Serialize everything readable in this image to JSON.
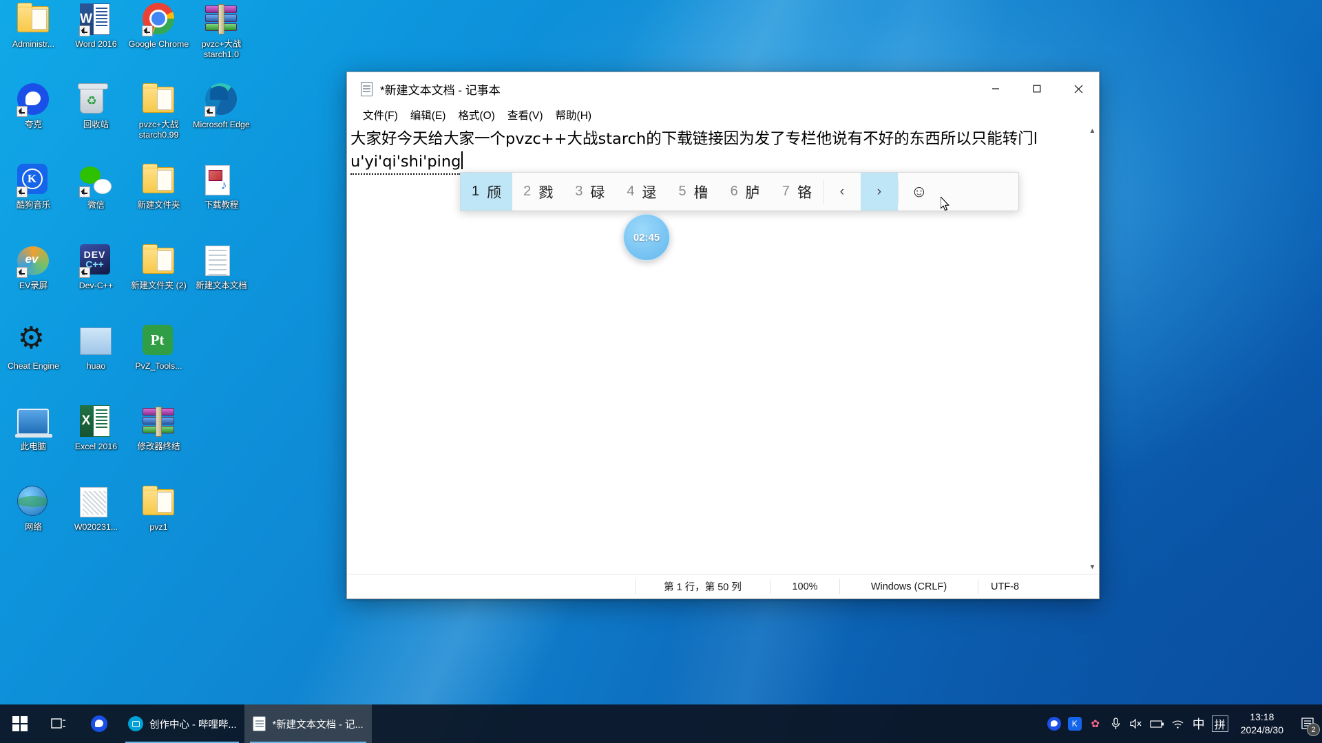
{
  "desktop": {
    "icons": [
      {
        "label": "Administr...",
        "icon": "user-folder-icon"
      },
      {
        "label": "Word 2016",
        "icon": "word-icon"
      },
      {
        "label": "Google Chrome",
        "icon": "chrome-icon"
      },
      {
        "label": "pvzc+大战starch1.0",
        "icon": "winrar-archive-icon"
      },
      {
        "label": "夸克",
        "icon": "quark-browser-icon"
      },
      {
        "label": "回收站",
        "icon": "recycle-bin-icon"
      },
      {
        "label": "pvzc+大战starch0.99",
        "icon": "folder-icon"
      },
      {
        "label": "Microsoft Edge",
        "icon": "edge-icon"
      },
      {
        "label": "酷狗音乐",
        "icon": "kugou-music-icon"
      },
      {
        "label": "微信",
        "icon": "wechat-icon"
      },
      {
        "label": "新建文件夹",
        "icon": "folder-icon"
      },
      {
        "label": "下载教程",
        "icon": "media-file-icon"
      },
      {
        "label": "EV录屏",
        "icon": "ev-recorder-icon"
      },
      {
        "label": "Dev-C++",
        "icon": "dev-cpp-icon"
      },
      {
        "label": "新建文件夹 (2)",
        "icon": "folder-icon"
      },
      {
        "label": "新建文本文档",
        "icon": "text-document-icon"
      },
      {
        "label": "Cheat Engine",
        "icon": "cheat-engine-icon"
      },
      {
        "label": "huao",
        "icon": "image-file-icon"
      },
      {
        "label": "PvZ_Tools...",
        "icon": "pvz-tools-icon"
      },
      {
        "label": "",
        "icon": "blank-icon"
      },
      {
        "label": "此电脑",
        "icon": "this-pc-icon"
      },
      {
        "label": "Excel 2016",
        "icon": "excel-icon"
      },
      {
        "label": "修改器终结",
        "icon": "winrar-archive-icon"
      },
      {
        "label": "",
        "icon": "blank-icon"
      },
      {
        "label": "网络",
        "icon": "network-icon"
      },
      {
        "label": "W020231...",
        "icon": "image-file-icon"
      },
      {
        "label": "pvz1",
        "icon": "folder-icon"
      }
    ]
  },
  "notepad": {
    "title": "*新建文本文档 - 记事本",
    "icon": "notepad-icon",
    "menus": [
      "文件(F)",
      "编辑(E)",
      "格式(O)",
      "查看(V)",
      "帮助(H)"
    ],
    "window_buttons": {
      "minimize": "minimize-button",
      "maximize": "maximize-button",
      "close": "close-button"
    },
    "text_line1": "大家好今天给大家一个pvzc++大战starch的下载链接因为发了专栏他说有不好的东西所以只能转门l",
    "text_line2": "u'yi'qi'shi'ping",
    "statusbar": {
      "position": "第 1 行，第 50 列",
      "zoom": "100%",
      "line_ending": "Windows (CRLF)",
      "encoding": "UTF-8"
    }
  },
  "ime": {
    "candidates": [
      {
        "num": "1",
        "word": "颀",
        "selected": true
      },
      {
        "num": "2",
        "word": "戮",
        "selected": false
      },
      {
        "num": "3",
        "word": "碌",
        "selected": false
      },
      {
        "num": "4",
        "word": "逯",
        "selected": false
      },
      {
        "num": "5",
        "word": "橹",
        "selected": false
      },
      {
        "num": "6",
        "word": "胪",
        "selected": false
      },
      {
        "num": "7",
        "word": "铬",
        "selected": false
      }
    ],
    "prev_label": "‹",
    "next_label": "›",
    "emoji_label": "☺",
    "next_hovered": true
  },
  "recording": {
    "timer": "02:45"
  },
  "taskbar": {
    "start_label": "start-button",
    "taskview_label": "task-view-button",
    "pinned": [
      {
        "name": "quark-browser-taskbar-icon"
      }
    ],
    "tasks": [
      {
        "label": "创作中心 - 哔哩哔...",
        "icon": "bilibili-icon",
        "active": false
      },
      {
        "label": "*新建文本文档 - 记...",
        "icon": "notepad-icon",
        "active": true
      }
    ],
    "tray": [
      {
        "name": "quark-tray-icon",
        "glyph": "◉"
      },
      {
        "name": "kugou-tray-icon",
        "glyph": "Ⓚ"
      },
      {
        "name": "flower-tray-icon",
        "glyph": "✿"
      },
      {
        "name": "microphone-tray-icon",
        "glyph": "🎤"
      },
      {
        "name": "volume-muted-tray-icon",
        "glyph": "🔇"
      },
      {
        "name": "battery-tray-icon",
        "glyph": "🔋"
      },
      {
        "name": "wifi-tray-icon",
        "glyph": "📶"
      },
      {
        "name": "ime-chinese-mode-icon",
        "glyph": "中"
      },
      {
        "name": "ime-pinyin-icon",
        "glyph": "拼"
      }
    ],
    "clock": {
      "time": "13:18",
      "date": "2024/8/30"
    },
    "notifications": {
      "count": "2",
      "name": "action-center-button"
    }
  },
  "colors": {
    "accent": "#bfe6f7",
    "desktop_blue": "#0d96dd",
    "taskbar": "#0c1424",
    "close_hover": "#e81123"
  }
}
